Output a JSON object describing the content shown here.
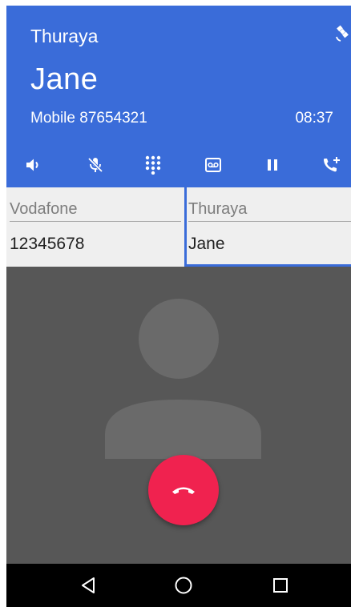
{
  "header": {
    "network": "Thuraya",
    "caller_name": "Jane",
    "line_info": "Mobile 87654321",
    "timer": "08:37",
    "background_color": "#3a6cd9",
    "network_icon": "satellite-icon"
  },
  "actions": [
    {
      "name": "speaker",
      "icon": "speaker-icon"
    },
    {
      "name": "mute",
      "icon": "mic-off-icon"
    },
    {
      "name": "dialpad",
      "icon": "dialpad-icon"
    },
    {
      "name": "voicemail",
      "icon": "voicemail-icon"
    },
    {
      "name": "hold",
      "icon": "pause-icon"
    },
    {
      "name": "add-call",
      "icon": "add-call-icon"
    }
  ],
  "calls": [
    {
      "network": "Vodafone",
      "name": "12345678",
      "active": false
    },
    {
      "network": "Thuraya",
      "name": "Jane",
      "active": true
    }
  ],
  "avatar": {
    "icon": "person-silhouette-icon"
  },
  "end_call": {
    "icon": "call-end-icon",
    "color": "#f0224f"
  },
  "navbar": [
    {
      "name": "back",
      "icon": "back-triangle-icon"
    },
    {
      "name": "home",
      "icon": "home-circle-icon"
    },
    {
      "name": "recents",
      "icon": "recents-square-icon"
    }
  ]
}
